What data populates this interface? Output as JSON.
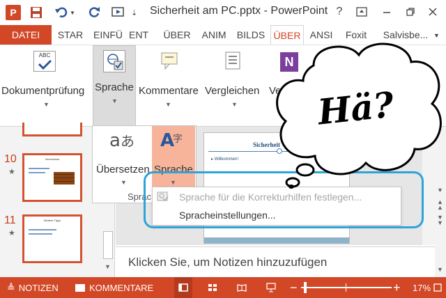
{
  "titlebar": {
    "title": "Sicherheit am PC.pptx - PowerPoint",
    "help": "?"
  },
  "tabs": [
    {
      "label": "DATEI"
    },
    {
      "label": "STAR"
    },
    {
      "label": "EINFÜ"
    },
    {
      "label": "ENT"
    },
    {
      "label": "ÜBER"
    },
    {
      "label": "ANIM"
    },
    {
      "label": "BILDS"
    },
    {
      "label": "ÜBER"
    },
    {
      "label": "ANSI"
    },
    {
      "label": "Foxit"
    },
    {
      "label": "Salvisbe..."
    }
  ],
  "ribbon": {
    "dokumentpruefung": "Dokumentprüfung",
    "sprache": "Sprache",
    "kommentare": "Kommentare",
    "vergleichen": "Vergleichen",
    "ver": "Ver",
    "uebersetzen": "Übersetzen",
    "sprache2": "Sprache",
    "group_label": "Sprac"
  },
  "slides": [
    {
      "number": "10",
      "title": "Virenschutz"
    },
    {
      "number": "11",
      "title": "Weitere Tipps"
    }
  ],
  "slide_preview": {
    "title": "Sicherheit",
    "bullet": "Willkommen!"
  },
  "menu": {
    "item1": "Sprache für die Korrekturhilfen festlegen...",
    "item2": "Spracheinstellungen..."
  },
  "notes_placeholder": "Klicken Sie, um Notizen hinzuzufügen",
  "status": {
    "notes": "NOTIZEN",
    "comments": "KOMMENTARE",
    "zoom": "17%"
  },
  "bubble_text": "Hä?",
  "colors": {
    "accent": "#d24726",
    "highlight_box": "#2ea3d8",
    "button_active": "#f7b49b"
  }
}
